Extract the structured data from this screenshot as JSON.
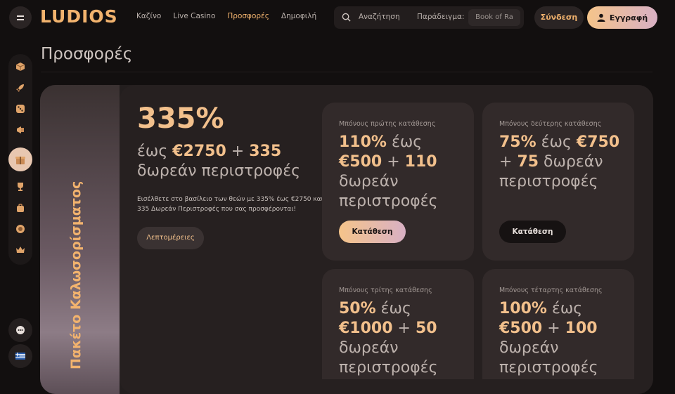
{
  "header": {
    "logo": "LUDIOS",
    "nav": [
      "Καζίνο",
      "Live Casino",
      "Προσφορές",
      "Δημοφιλή"
    ],
    "active_nav": "Προσφορές",
    "search_placeholder": "Αναζήτηση",
    "search_example_label": "Παράδειγμα:",
    "search_example_value": "Book of Ra",
    "login_label": "Σύνδεση",
    "register_label": "Εγγραφή"
  },
  "sidebar": {
    "icons": [
      "cube-icon",
      "rocket-icon",
      "dice-icon",
      "megaphone-icon",
      "gift-icon",
      "trophy-icon",
      "bag-icon",
      "poker-chip-icon",
      "crown-icon"
    ],
    "active_icon": "gift-icon",
    "bottom": [
      "chat-icon",
      "greek-flag-icon"
    ]
  },
  "page": {
    "title": "Προσφορές"
  },
  "hero": {
    "vertical_label": "Πακέτο Καλωσορίσματος",
    "big_pct": "335%",
    "headline_1": "έως ",
    "headline_amount": "€2750",
    "headline_2": " + ",
    "headline_spins": "335",
    "headline_3": " δωρεάν περιστροφές",
    "description": "Εισέλθετε στο βασίλειο των θεών με 335% έως €2750 και 335 Δωρεάν Περιστροφές που σας προσφέρονται!",
    "details_label": "Λεπτομέρειες"
  },
  "cards": [
    {
      "title": "Μπόνους πρώτης κατάθεσης",
      "pct": "110%",
      "mid": " έως ",
      "amount": "€500",
      "plus": " + ",
      "spins": "110",
      "rest": " δωρεάν περιστροφές",
      "button": "Κατάθεση"
    },
    {
      "title": "Μπόνους δεύτερης κατάθεσης",
      "pct": "75%",
      "mid": " έως ",
      "amount": "€750",
      "plus": " + ",
      "spins": "75",
      "rest": " δωρεάν περιστροφές",
      "button": "Κατάθεση"
    },
    {
      "title": "Μπόνους τρίτης κατάθεσης",
      "pct": "50%",
      "mid": " έως ",
      "amount": "€1000",
      "plus": " + ",
      "spins": "50",
      "rest": " δωρεάν περιστροφές"
    },
    {
      "title": "Μπόνους τέταρτης κατάθεσης",
      "pct": "100%",
      "mid": " έως ",
      "amount": "€500",
      "plus": " + ",
      "spins": "100",
      "rest": " δωρεάν περιστροφές"
    }
  ],
  "colors": {
    "accent": "#f2b36e",
    "background": "#120f0f",
    "card": "#322a2a"
  }
}
